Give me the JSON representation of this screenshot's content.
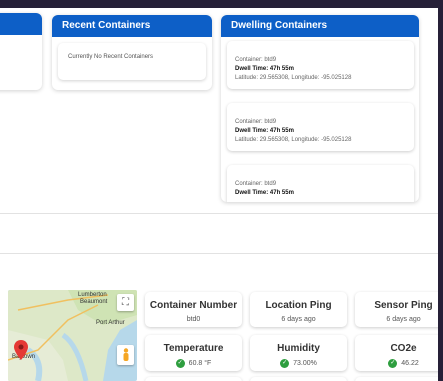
{
  "recent": {
    "title": "Recent Containers",
    "empty_text": "Currently No Recent Containers"
  },
  "dwelling": {
    "title": "Dwelling Containers",
    "items": [
      {
        "container": "Container: btd9",
        "dwell": "Dwell Time: 47h 55m",
        "coords": "Latitude: 29.565308, Longitude: -95.025128"
      },
      {
        "container": "Container: btd9",
        "dwell": "Dwell Time: 47h 55m",
        "coords": "Latitude: 29.565308, Longitude: -95.025128"
      },
      {
        "container": "Container: btd9",
        "dwell": "Dwell Time: 47h 55m",
        "coords": ""
      }
    ]
  },
  "map": {
    "labels": [
      "Lumberton",
      "Beaumont",
      "Port Arthur",
      "Baytown"
    ],
    "icons": {
      "fullscreen": "fullscreen-icon",
      "pegman": "pegman-icon",
      "marker": "map-marker-icon"
    }
  },
  "stats": {
    "container_number": {
      "title": "Container Number",
      "value": "btd0"
    },
    "location_ping": {
      "title": "Location Ping",
      "value": "6 days ago"
    },
    "sensor_ping": {
      "title": "Sensor Ping",
      "value": "6 days ago"
    },
    "temperature": {
      "title": "Temperature",
      "value": "60.8 °F"
    },
    "humidity": {
      "title": "Humidity",
      "value": "73.00%"
    },
    "co2e": {
      "title": "CO2e",
      "value": "46.22"
    }
  },
  "colors": {
    "header_blue": "#0d5fc7",
    "ok_green": "#2e9e3f",
    "background": "#262038"
  }
}
